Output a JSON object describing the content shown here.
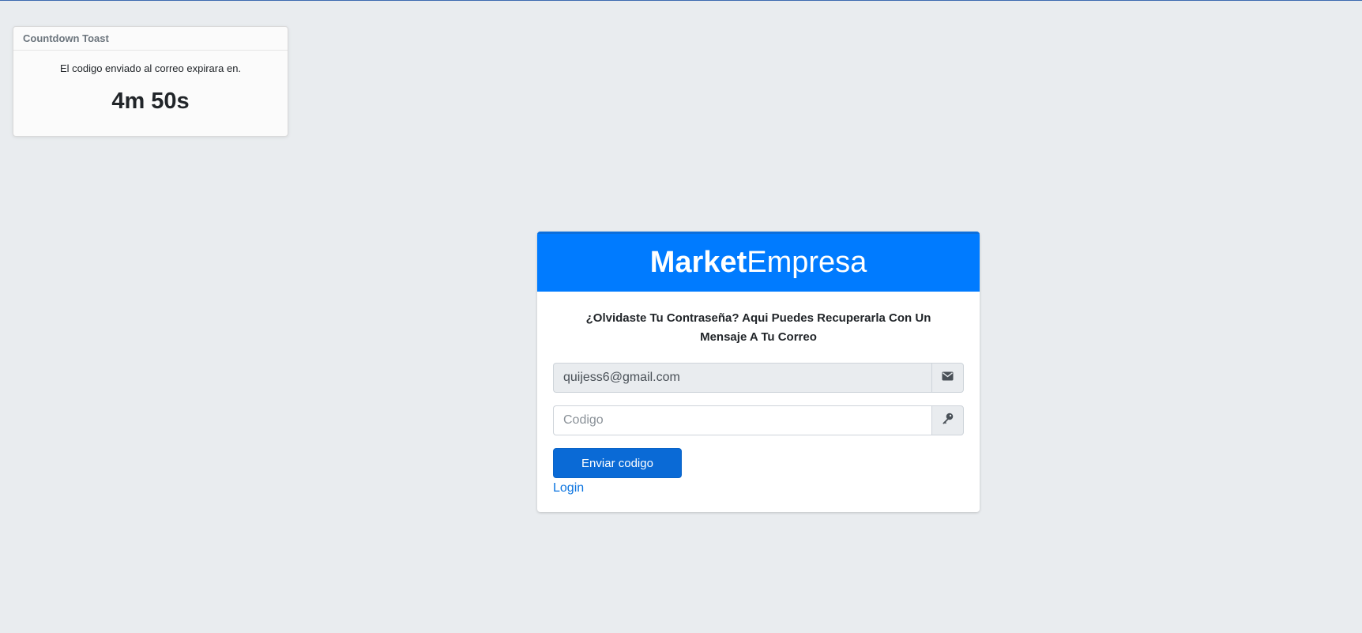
{
  "toast": {
    "title": "Countdown Toast",
    "message": "El codigo enviado al correo expirara en.",
    "countdown": "4m 50s"
  },
  "card": {
    "brand_bold": "Market",
    "brand_light": "Empresa",
    "title": "¿Olvidaste Tu Contraseña? Aqui Puedes Recuperarla Con Un Mensaje A Tu Correo",
    "email": {
      "value": "quijess6@gmail.com",
      "icon": "envelope-icon"
    },
    "code": {
      "placeholder": "Codigo",
      "value": "",
      "icon": "key-icon"
    },
    "submit_label": "Enviar codigo",
    "login_label": "Login"
  },
  "colors": {
    "page_background": "#e9ecef",
    "header_blue": "#007bff",
    "button_blue": "#0a6ad6",
    "link_blue": "#0b74e0"
  }
}
